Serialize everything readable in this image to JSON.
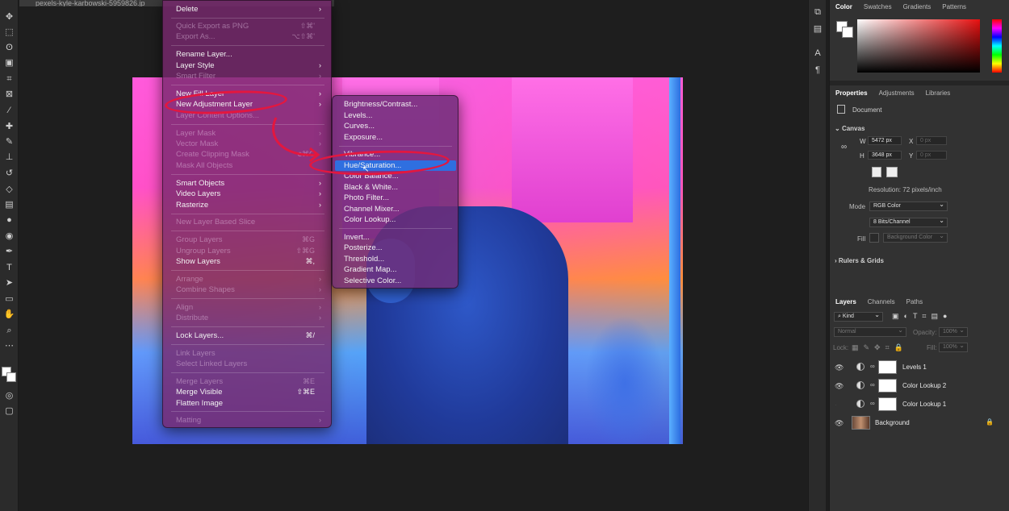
{
  "document": {
    "tab_title": "pexels-kyle-karbowski-5959826.jp"
  },
  "toolbar": {
    "tools": [
      "move-icon",
      "marquee-icon",
      "lasso-icon",
      "object-select-icon",
      "crop-icon",
      "frame-icon",
      "eyedropper-icon",
      "healing-icon",
      "brush-icon",
      "stamp-icon",
      "history-brush-icon",
      "eraser-icon",
      "gradient-icon",
      "blur-icon",
      "dodge-icon",
      "pen-icon",
      "type-icon",
      "path-select-icon",
      "shape-icon",
      "hand-icon",
      "zoom-icon",
      "more-icon"
    ]
  },
  "layer_menu": {
    "items": [
      {
        "label": "Delete",
        "disabled": false,
        "arrow": true,
        "shortcut": ""
      },
      {
        "label": "Quick Export as PNG",
        "disabled": true,
        "arrow": false,
        "shortcut": "⇧⌘'"
      },
      {
        "label": "Export As...",
        "disabled": true,
        "arrow": false,
        "shortcut": "⌥⇧⌘'"
      },
      {
        "label": "Rename Layer...",
        "disabled": false,
        "arrow": false,
        "shortcut": ""
      },
      {
        "label": "Layer Style",
        "disabled": false,
        "arrow": true,
        "shortcut": ""
      },
      {
        "label": "Smart Filter",
        "disabled": true,
        "arrow": true,
        "shortcut": ""
      },
      {
        "label": "New Fill Layer",
        "disabled": false,
        "arrow": true,
        "shortcut": ""
      },
      {
        "label": "New Adjustment Layer",
        "disabled": false,
        "arrow": true,
        "shortcut": ""
      },
      {
        "label": "Layer Content Options...",
        "disabled": true,
        "arrow": false,
        "shortcut": ""
      },
      {
        "label": "Layer Mask",
        "disabled": true,
        "arrow": true,
        "shortcut": ""
      },
      {
        "label": "Vector Mask",
        "disabled": true,
        "arrow": true,
        "shortcut": ""
      },
      {
        "label": "Create Clipping Mask",
        "disabled": true,
        "arrow": false,
        "shortcut": "⌥⌘G"
      },
      {
        "label": "Mask All Objects",
        "disabled": true,
        "arrow": false,
        "shortcut": ""
      },
      {
        "label": "Smart Objects",
        "disabled": false,
        "arrow": true,
        "shortcut": ""
      },
      {
        "label": "Video Layers",
        "disabled": false,
        "arrow": true,
        "shortcut": ""
      },
      {
        "label": "Rasterize",
        "disabled": false,
        "arrow": true,
        "shortcut": ""
      },
      {
        "label": "New Layer Based Slice",
        "disabled": true,
        "arrow": false,
        "shortcut": ""
      },
      {
        "label": "Group Layers",
        "disabled": true,
        "arrow": false,
        "shortcut": "⌘G"
      },
      {
        "label": "Ungroup Layers",
        "disabled": true,
        "arrow": false,
        "shortcut": "⇧⌘G"
      },
      {
        "label": "Show Layers",
        "disabled": false,
        "arrow": false,
        "shortcut": "⌘,"
      },
      {
        "label": "Arrange",
        "disabled": true,
        "arrow": true,
        "shortcut": ""
      },
      {
        "label": "Combine Shapes",
        "disabled": true,
        "arrow": true,
        "shortcut": ""
      },
      {
        "label": "Align",
        "disabled": true,
        "arrow": true,
        "shortcut": ""
      },
      {
        "label": "Distribute",
        "disabled": true,
        "arrow": true,
        "shortcut": ""
      },
      {
        "label": "Lock Layers...",
        "disabled": false,
        "arrow": false,
        "shortcut": "⌘/"
      },
      {
        "label": "Link Layers",
        "disabled": true,
        "arrow": false,
        "shortcut": ""
      },
      {
        "label": "Select Linked Layers",
        "disabled": true,
        "arrow": false,
        "shortcut": ""
      },
      {
        "label": "Merge Layers",
        "disabled": true,
        "arrow": false,
        "shortcut": "⌘E"
      },
      {
        "label": "Merge Visible",
        "disabled": false,
        "arrow": false,
        "shortcut": "⇧⌘E"
      },
      {
        "label": "Flatten Image",
        "disabled": false,
        "arrow": false,
        "shortcut": ""
      },
      {
        "label": "Matting",
        "disabled": true,
        "arrow": true,
        "shortcut": ""
      }
    ]
  },
  "adjustment_submenu": {
    "items": [
      {
        "label": "Brightness/Contrast...",
        "selected": false
      },
      {
        "label": "Levels...",
        "selected": false
      },
      {
        "label": "Curves...",
        "selected": false
      },
      {
        "label": "Exposure...",
        "selected": false
      },
      {
        "label": "Vibrance...",
        "selected": false
      },
      {
        "label": "Hue/Saturation...",
        "selected": true
      },
      {
        "label": "Color Balance...",
        "selected": false
      },
      {
        "label": "Black & White...",
        "selected": false
      },
      {
        "label": "Photo Filter...",
        "selected": false
      },
      {
        "label": "Channel Mixer...",
        "selected": false
      },
      {
        "label": "Color Lookup...",
        "selected": false
      },
      {
        "label": "Invert...",
        "selected": false
      },
      {
        "label": "Posterize...",
        "selected": false
      },
      {
        "label": "Threshold...",
        "selected": false
      },
      {
        "label": "Gradient Map...",
        "selected": false
      },
      {
        "label": "Selective Color...",
        "selected": false
      }
    ]
  },
  "color_panel": {
    "tabs": [
      "Color",
      "Swatches",
      "Gradients",
      "Patterns"
    ],
    "active": "Color"
  },
  "properties_panel": {
    "tabs": [
      "Properties",
      "Adjustments",
      "Libraries"
    ],
    "doc_label": "Document",
    "canvas_section": "Canvas",
    "w_label": "W",
    "w_value": "5472 px",
    "h_label": "H",
    "h_value": "3648 px",
    "x_label": "X",
    "x_placeholder": "0 px",
    "y_label": "Y",
    "y_placeholder": "0 px",
    "resolution": "Resolution: 72 pixels/inch",
    "mode_label": "Mode",
    "mode_value": "RGB Color",
    "bits_value": "8 Bits/Channel",
    "fill_label": "Fill",
    "fill_value": "Background Color",
    "rulers_section": "Rulers & Grids"
  },
  "layers_panel": {
    "tabs": [
      "Layers",
      "Channels",
      "Paths"
    ],
    "kind_label": "Kind",
    "blend_mode": "Normal",
    "opacity_label": "Opacity:",
    "opacity_value": "100%",
    "lock_label": "Lock:",
    "fill_label": "Fill:",
    "fill_value": "100%",
    "layers": [
      {
        "name": "Levels 1",
        "type": "adjustment",
        "visible": true
      },
      {
        "name": "Color Lookup 2",
        "type": "adjustment",
        "visible": true
      },
      {
        "name": "Color Lookup 1",
        "type": "adjustment",
        "visible": false
      },
      {
        "name": "Background",
        "type": "image",
        "visible": true
      }
    ]
  },
  "colors": {
    "selection": "#2f6fe0",
    "annotation": "#e3173f",
    "menu_bg": "#782870"
  }
}
